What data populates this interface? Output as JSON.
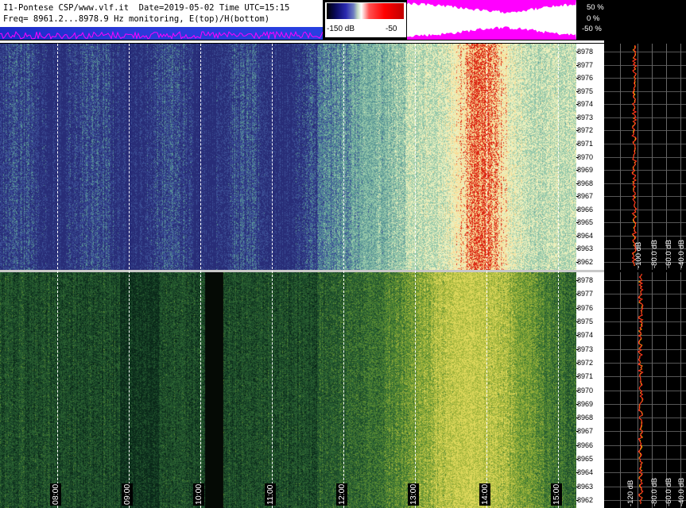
{
  "header": {
    "line1": "I1-Pontese CSP/www.vlf.it  Date=2019-05-02 Time UTC=15:15",
    "line2": "Freq= 8961.2...8978.9 Hz monitoring, E(top)/H(bottom)"
  },
  "colorbar": {
    "min_label": "-150 dB",
    "max_label": "-50"
  },
  "agc_scale": [
    "50 %",
    "0 %",
    "-50 %"
  ],
  "freq_ticks": [
    "8978",
    "8977",
    "8976",
    "8975",
    "8974",
    "8973",
    "8972",
    "8971",
    "8970",
    "8969",
    "8968",
    "8967",
    "8966",
    "8965",
    "8964",
    "8963",
    "8962"
  ],
  "time_labels": [
    "08:00",
    "09:00",
    "10:00",
    "11:00",
    "12:00",
    "13:00",
    "14:00",
    "15:00"
  ],
  "spectrum_top": {
    "db_labels": [
      "-100 dB",
      "-80.0 dB",
      "-60.0 dB",
      "-40.0 dB"
    ]
  },
  "spectrum_bottom": {
    "db_labels": [
      "-120 dB",
      "-80.0 dB",
      "-60.0 dB",
      "-40.0 dB"
    ]
  },
  "colors": {
    "trace_yellow": "#ffe000",
    "trace_red": "#ff2020",
    "agc_magenta": "#ff00ff",
    "header_blue": "#2233cc"
  }
}
